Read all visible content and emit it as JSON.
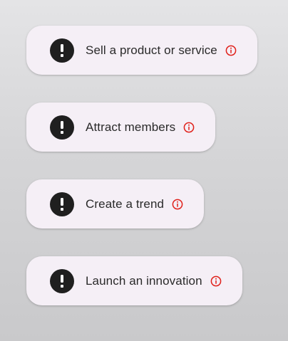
{
  "goals": [
    {
      "label": "Sell a product or service",
      "status_icon": "alert-icon",
      "info_icon": "info-icon"
    },
    {
      "label": "Attract members",
      "status_icon": "alert-icon",
      "info_icon": "info-icon"
    },
    {
      "label": "Create a trend",
      "status_icon": "alert-icon",
      "info_icon": "info-icon"
    },
    {
      "label": "Launch an innovation",
      "status_icon": "alert-icon",
      "info_icon": "info-icon"
    }
  ],
  "colors": {
    "card_background": "#f5eff6",
    "alert_icon": "#1f1f1f",
    "info_icon": "#e0201a",
    "label_text": "#2a2a2a"
  }
}
